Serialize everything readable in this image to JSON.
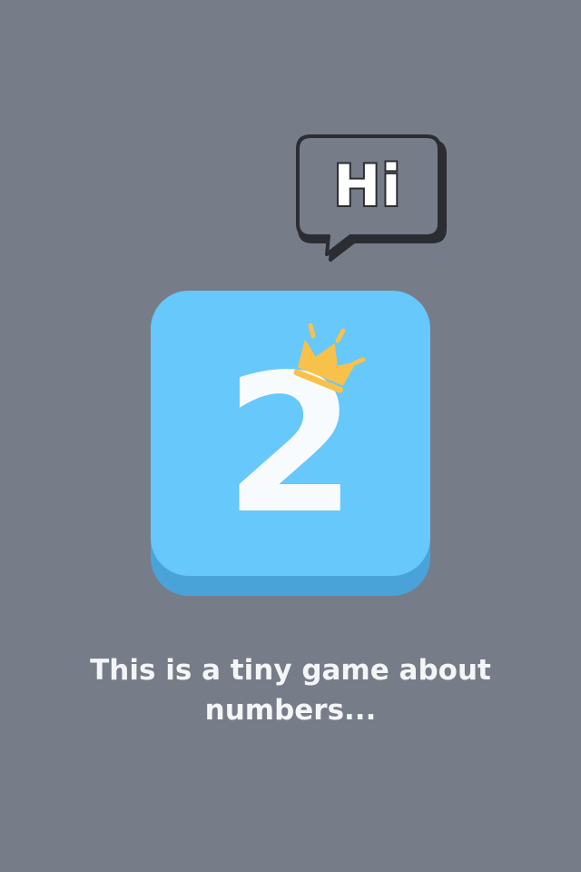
{
  "speech_bubble": {
    "text": "Hi"
  },
  "tile": {
    "number": "2",
    "icon": "crown-icon"
  },
  "caption": {
    "text": "This is a tiny game about numbers..."
  },
  "colors": {
    "background": "#777c89",
    "tile_face": "#66c8fb",
    "tile_shadow": "#4aa3d8",
    "crown": "#f8c24a",
    "bubble_outline": "#2b2d33",
    "text_light": "#f4f5f7"
  }
}
